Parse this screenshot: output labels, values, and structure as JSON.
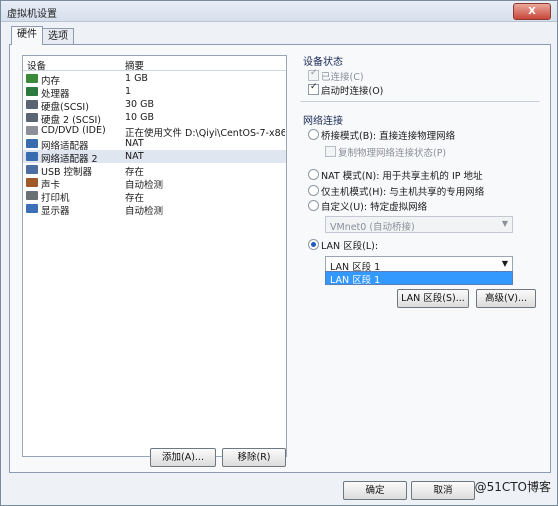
{
  "window": {
    "title": "虚拟机设置",
    "close_label": "X"
  },
  "tabs": [
    {
      "label": "硬件"
    },
    {
      "label": "选项"
    }
  ],
  "device_list": {
    "headers": {
      "device": "设备",
      "summary": "摘要"
    },
    "rows": [
      {
        "name": "内存",
        "summary": "1 GB",
        "icon": "memory-icon",
        "color": "#3a8a3a"
      },
      {
        "name": "处理器",
        "summary": "1",
        "icon": "processor-icon",
        "color": "#2d7a3f"
      },
      {
        "name": "硬盘(SCSI)",
        "summary": "30 GB",
        "icon": "hard-disk-icon",
        "color": "#5a6472"
      },
      {
        "name": "硬盘 2 (SCSI)",
        "summary": "10 GB",
        "icon": "hard-disk-icon",
        "color": "#5a6472"
      },
      {
        "name": "CD/DVD (IDE)",
        "summary": "正在使用文件 D:\\Qiyi\\CentOS-7-x86...",
        "icon": "cd-dvd-icon",
        "color": "#8a8f98"
      },
      {
        "name": "网络适配器",
        "summary": "NAT",
        "icon": "network-adapter-icon",
        "color": "#3a6db0"
      },
      {
        "name": "网络适配器 2",
        "summary": "NAT",
        "icon": "network-adapter-icon",
        "color": "#3a6db0"
      },
      {
        "name": "USB 控制器",
        "summary": "存在",
        "icon": "usb-controller-icon",
        "color": "#4a6fa0"
      },
      {
        "name": "声卡",
        "summary": "自动检测",
        "icon": "sound-card-icon",
        "color": "#a05a28"
      },
      {
        "name": "打印机",
        "summary": "存在",
        "icon": "printer-icon",
        "color": "#6b6f76"
      },
      {
        "name": "显示器",
        "summary": "自动检测",
        "icon": "display-icon",
        "color": "#3b6fb8"
      }
    ],
    "selected_index": 6,
    "add_label": "添加(A)...",
    "remove_label": "移除(R)"
  },
  "device_status": {
    "title": "设备状态",
    "connected_label": "已连接(C)",
    "connect_at_power_on_label": "启动时连接(O)"
  },
  "network": {
    "title": "网络连接",
    "bridged_label": "桥接模式(B): 直接连接物理网络",
    "replicate_label": "复制物理网络连接状态(P)",
    "nat_label": "NAT 模式(N): 用于共享主机的 IP 地址",
    "host_only_label": "仅主机模式(H): 与主机共享的专用网络",
    "custom_label": "自定义(U): 特定虚拟网络",
    "custom_select_value": "VMnet0 (自动桥接)",
    "lan_segment_label": "LAN 区段(L):",
    "lan_select_value": "LAN 区段 1",
    "lan_dropdown_option": "LAN 区段 1",
    "lan_segments_button": "LAN 区段(S)...",
    "advanced_button": "高级(V)..."
  },
  "footer": {
    "ok_label": "确定",
    "cancel_label": "取消",
    "watermark": "@51CTO博客"
  }
}
